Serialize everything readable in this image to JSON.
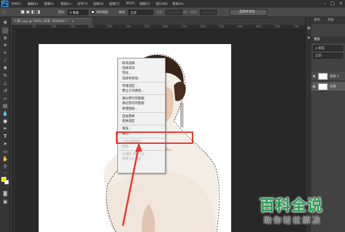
{
  "app": {
    "logo": "Ps"
  },
  "menubar": {
    "items": [
      "文件(F)",
      "编辑(E)",
      "图像(I)",
      "图层(L)",
      "文字(Y)",
      "选择(S)",
      "滤镜(T)",
      "3D(D)",
      "视图(V)",
      "窗口(W)",
      "帮助(H)"
    ],
    "window_controls": [
      "–",
      "□",
      "×"
    ]
  },
  "options_bar": {
    "feather_label": "羽化:",
    "feather_value": "0 像素",
    "antialias_label": "消除锯齿",
    "style_label": "样式:",
    "style_value": "正常",
    "width_label": "宽度:",
    "height_label": "高度:",
    "select_mask_button": "选择并遮住..."
  },
  "document": {
    "tab_title": "人像1.jpg @ 100% (背景, RGB/8#) *",
    "ruler_ticks": [
      "50",
      "100",
      "150",
      "200",
      "250",
      "300",
      "350",
      "400",
      "450",
      "500",
      "550",
      "600",
      "650",
      "700",
      "750"
    ]
  },
  "context_menu": {
    "groups": [
      {
        "items": [
          {
            "label": "取消选择",
            "enabled": true
          },
          {
            "label": "选择反向",
            "enabled": true
          },
          {
            "label": "羽化...",
            "enabled": true
          },
          {
            "label": "选择并遮住...",
            "enabled": true
          }
        ]
      },
      {
        "items": [
          {
            "label": "存储选区...",
            "enabled": true
          },
          {
            "label": "建立工作路径...",
            "enabled": true
          }
        ]
      },
      {
        "items": [
          {
            "label": "通过拷贝的图层",
            "enabled": true
          },
          {
            "label": "通过剪切的图层",
            "enabled": true
          },
          {
            "label": "新建图层...",
            "enabled": true
          }
        ]
      },
      {
        "items": [
          {
            "label": "自由变换",
            "enabled": true
          },
          {
            "label": "变换选区",
            "enabled": true
          }
        ]
      },
      {
        "items": [
          {
            "label": "填充...",
            "enabled": true
          },
          {
            "label": "描边...",
            "enabled": true
          }
        ]
      },
      {
        "items": [
          {
            "label": "上次滤镜操作",
            "enabled": false
          },
          {
            "label": "渐隐...",
            "enabled": false
          }
        ]
      },
      {
        "items": [
          {
            "label": "从选区 3D 凸出",
            "enabled": false
          },
          {
            "label": "新建 3D 模型",
            "enabled": false
          }
        ]
      }
    ]
  },
  "panels": {
    "top_tabs": [
      "颜色",
      "色板"
    ],
    "layers_tabs": [
      "图层"
    ],
    "filter_label": "ρ 类型",
    "blend_mode": "正常",
    "layers": [
      {
        "name": "图层 1"
      },
      {
        "name": "背景"
      }
    ]
  },
  "watermark": {
    "main": "百科全说",
    "sub": "助你轻松解决"
  },
  "colors": {
    "highlight": "#e8362c",
    "watermark_green": "#1e9e4a",
    "foreground": "#f2e200"
  }
}
